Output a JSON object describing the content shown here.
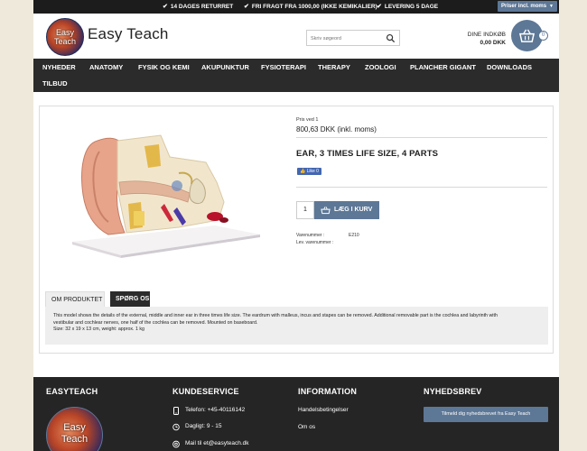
{
  "topbar": {
    "usps": [
      "14 DAGES RETURRET",
      "FRI FRAGT FRA 1000,00 (IKKE KEMIKALIER)",
      "LEVERING 5 DAGE"
    ],
    "price_toggle": "Priser incl. moms"
  },
  "header": {
    "logo_line1": "Easy",
    "logo_line2": "Teach",
    "brand": "Easy Teach",
    "search_placeholder": "Skriv søgeord",
    "cart_label": "DINE INDKØB",
    "cart_amount": "0,00 DKK",
    "cart_count": "0"
  },
  "nav": {
    "items": [
      "NYHEDER",
      "ANATOMY",
      "FYSIK OG KEMI",
      "AKUPUNKTUR",
      "FYSIOTERAPI",
      "THERAPY",
      "ZOOLOGI",
      "PLANCHER GIGANT",
      "DOWNLOADS",
      "TILBUD"
    ]
  },
  "product": {
    "pris_ved": "Pris ved  1",
    "price": "800,63 DKK (inkl. moms)",
    "title": "EAR, 3 TIMES LIFE SIZE, 4 PARTS",
    "fb_like": "Like 0",
    "quantity": "1",
    "add_to_cart": "LÆG I KURV",
    "varenummer_label": "Varenummer :",
    "varenummer_value": "E210",
    "lev_varenummer_label": "Lev. varenummer :",
    "lev_varenummer_value": ""
  },
  "tabs": {
    "active": "OM PRODUKTET",
    "inactive": "SPØRG OS"
  },
  "description": {
    "line1": "This model shows the details of the external, middle and inner ear in three times life size. The eardrum with malleus, incus and stapes can be removed. Additional removable part is the cochlea and labyrinth with",
    "line2": "vestibular and cochlear nerves, one half of the cochlea can be removed. Mounted on baseboard.",
    "line3": "Size: 32 x 19 x 13 cm, weight: approx. 1 kg"
  },
  "footer": {
    "col1_title": "EASYTEACH",
    "col2_title": "KUNDESERVICE",
    "col3_title": "INFORMATION",
    "col4_title": "NYHEDSBREV",
    "logo_line1": "Easy",
    "logo_line2": "Teach",
    "phone": "Telefon: +45-40116142",
    "hours": "Dagligt: 9 - 15",
    "mail": "Mail til et@easyteach.dk",
    "info_links": [
      "Handelsbetingelser",
      "Om os"
    ],
    "newsletter_button": "Tilmeld dig nyhedsbrevet fra Easy Teach"
  },
  "colors": {
    "accent": "#5d7796",
    "dark": "#2b2b2b",
    "page_bg": "#efe9dc"
  }
}
